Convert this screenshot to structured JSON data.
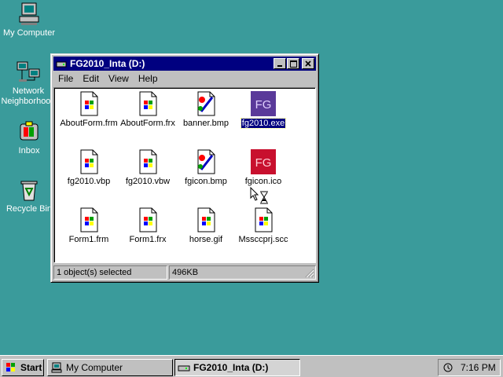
{
  "desktop": {
    "icons": [
      {
        "label": "My Computer",
        "icon": "computer-icon"
      },
      {
        "label": "Network Neighborhood",
        "icon": "network-icon"
      },
      {
        "label": "Inbox",
        "icon": "inbox-icon"
      },
      {
        "label": "Recycle Bin",
        "icon": "recycle-bin-icon"
      }
    ]
  },
  "window": {
    "title": "FG2010_Inta (D:)",
    "menu": [
      "File",
      "Edit",
      "View",
      "Help"
    ],
    "files": [
      {
        "name": "AboutForm.frm",
        "icon": "vb-file-icon"
      },
      {
        "name": "AboutForm.frx",
        "icon": "vb-file-icon"
      },
      {
        "name": "banner.bmp",
        "icon": "bitmap-icon"
      },
      {
        "name": "fg2010.exe",
        "icon": "fg-app-icon",
        "selected": true
      },
      {
        "name": "fg2010.vbp",
        "icon": "vb-file-icon"
      },
      {
        "name": "fg2010.vbw",
        "icon": "vb-file-icon"
      },
      {
        "name": "fgicon.bmp",
        "icon": "bitmap-icon"
      },
      {
        "name": "fgicon.ico",
        "icon": "fg-ico-icon"
      },
      {
        "name": "Form1.frm",
        "icon": "vb-file-icon"
      },
      {
        "name": "Form1.frx",
        "icon": "vb-file-icon"
      },
      {
        "name": "horse.gif",
        "icon": "vb-file-icon"
      },
      {
        "name": "Mssccprj.scc",
        "icon": "vb-file-icon"
      }
    ],
    "status": {
      "selection": "1 object(s) selected",
      "size": "496KB"
    }
  },
  "taskbar": {
    "start_label": "Start",
    "buttons": [
      {
        "label": "My Computer",
        "pressed": false
      },
      {
        "label": "FG2010_Inta (D:)",
        "pressed": true
      }
    ],
    "clock": "7:16 PM"
  },
  "colors": {
    "desktop": "#3A9B9B",
    "titlebar": "#000080",
    "selection": "#000080"
  }
}
